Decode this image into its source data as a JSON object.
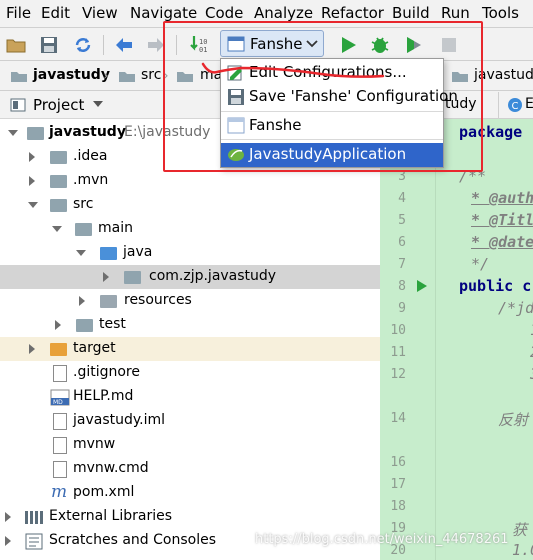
{
  "menubar": {
    "items": [
      {
        "label": "File",
        "mnemonic": "F"
      },
      {
        "label": "Edit",
        "mnemonic": "E"
      },
      {
        "label": "View",
        "mnemonic": "V"
      },
      {
        "label": "Navigate",
        "mnemonic": "N"
      },
      {
        "label": "Code",
        "mnemonic": "C"
      },
      {
        "label": "Analyze",
        "mnemonic": "z"
      },
      {
        "label": "Refactor",
        "mnemonic": "R"
      },
      {
        "label": "Build",
        "mnemonic": "B"
      },
      {
        "label": "Run",
        "mnemonic": "u"
      },
      {
        "label": "Tools",
        "mnemonic": "T"
      }
    ]
  },
  "toolbar": {
    "run_config_label": "Fanshe",
    "icons": [
      "open-folder-icon",
      "save-icon",
      "sync-icon",
      "back-icon",
      "forward-icon",
      "build-icon",
      "run-icon",
      "debug-icon",
      "coverage-icon",
      "stop-icon"
    ]
  },
  "breadcrumb": {
    "items": [
      "javastudy",
      "src",
      "ma",
      "javastudy"
    ]
  },
  "project_panel": {
    "title": "Project",
    "tree": [
      {
        "label": "javastudy",
        "suffix": "E:\\javastudy"
      },
      {
        "label": ".idea"
      },
      {
        "label": ".mvn"
      },
      {
        "label": "src"
      },
      {
        "label": "main"
      },
      {
        "label": "java"
      },
      {
        "label": "com.zjp.javastudy"
      },
      {
        "label": "resources"
      },
      {
        "label": "test"
      },
      {
        "label": "target"
      },
      {
        "label": ".gitignore"
      },
      {
        "label": "HELP.md"
      },
      {
        "label": "javastudy.iml"
      },
      {
        "label": "mvnw"
      },
      {
        "label": "mvnw.cmd"
      },
      {
        "label": "pom.xml"
      },
      {
        "label": "External Libraries"
      },
      {
        "label": "Scratches and Consoles"
      }
    ]
  },
  "editor": {
    "tab_label": "tudy",
    "line_numbers": [
      "3",
      "4",
      "5",
      "6",
      "7",
      "8",
      "9",
      "10",
      "11",
      "12",
      "13",
      "14",
      "15",
      "16",
      "17",
      "18",
      "19",
      "20"
    ],
    "code": {
      "package": "package",
      "doc_open": "/**",
      "author": "* @auth",
      "title": "* @Titl",
      "date": "* @date",
      "doc_close": "*/",
      "public": "public c",
      "comment": "/*jd",
      "c11": "1",
      "c12": "2",
      "c13": "3",
      "reflect": "反射",
      "get": "获",
      "c20": "1.0"
    }
  },
  "popup": {
    "items": [
      {
        "label": "Edit Configurations..."
      },
      {
        "label": "Save 'Fanshe' Configuration"
      },
      {
        "label": "Fanshe"
      },
      {
        "label": "JavastudyApplication"
      }
    ]
  },
  "watermark": "https://blog.csdn.net/weixin_44678261",
  "colors": {
    "accent": "#2f65ca",
    "annotation": "#e8272d",
    "editor_bg": "#c7edcc",
    "run_green": "#2aa33d"
  }
}
